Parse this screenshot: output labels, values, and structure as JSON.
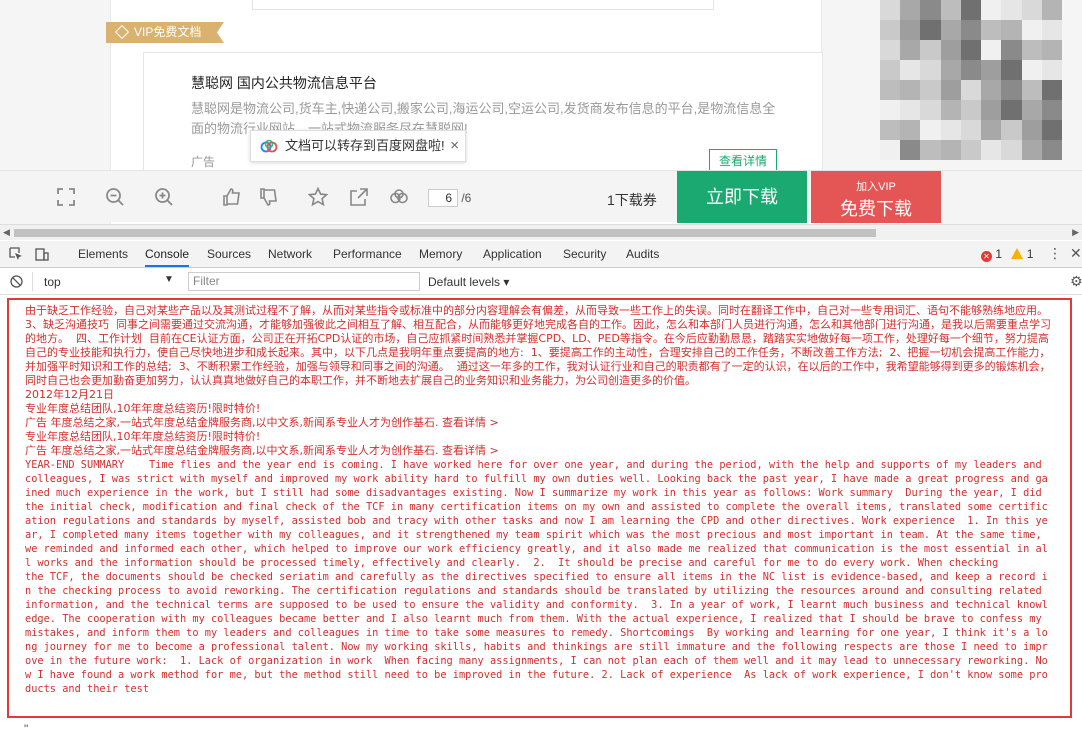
{
  "vip_tag": "VIP免费文档",
  "ad": {
    "title": "慧聪网 国内公共物流信息平台",
    "desc": "慧聪网是物流公司,货车主,快递公司,搬家公司,海运公司,空运公司,发货商发布信息的平台,是物流信息全面的物流行业网站，一站式物流服务尽在慧聪网!",
    "label": "广告",
    "button": "查看详情"
  },
  "tip": {
    "text": "文档可以转存到百度网盘啦!",
    "close": "×"
  },
  "toolbar": {
    "page_current": "6",
    "page_total": "/6",
    "coupon": "1下载券",
    "download": "立即下载",
    "vip_line1": "加入VIP",
    "vip_line2": "免费下载"
  },
  "devtools": {
    "tabs": [
      "Elements",
      "Console",
      "Sources",
      "Network",
      "Performance",
      "Memory",
      "Application",
      "Security",
      "Audits"
    ],
    "active_tab": "Console",
    "error_count": "1",
    "warning_count": "1",
    "context": "top",
    "filter_placeholder": "Filter",
    "levels": "Default levels"
  },
  "console_lines": {
    "l1": "由于缺乏工作经验，自己对某些产品以及其测试过程不了解，从而对某些指令或标准中的部分内容理解会有偏差，从而导致一些工作上的失误。同时在翻译工作中，自己对一些专用词汇、语句不能够熟练地应用。  3、缺乏沟通技巧  同事之间需要通过交流沟通，才能够加强彼此之间相互了解、相互配合，从而能够更好地完成各自的工作。因此，怎么和本部门人员进行沟通，怎么和其他部门进行沟通，是我以后需要重点学习的地方。  四、工作计划  目前在CE认证方面，公司正在开拓CPD认证的市场，自己应抓紧时间熟悉并掌握CPD、LD、PED等指令。在今后应勤勤恳恳，踏踏实实地做好每一项工作，处理好每一个细节，努力提高自己的专业技能和执行力，使自己尽快地进步和成长起来。其中，以下几点是我明年重点要提高的地方:  1、要提高工作的主动性，合理安排自己的工作任务，不断改善工作方法;  2、把握一切机会提高工作能力，并加强平时知识和工作的总结;  3、不断积累工作经验，加强与领导和同事之间的沟通。  通过这一年多的工作，我对认证行业和自己的职责都有了一定的认识，在以后的工作中，我希望能够得到更多的锻炼机会，同时自己也会更加勤奋更加努力，认认真真地做好自己的本职工作，并不断地去扩展自己的业务知识和业务能力，为公司创造更多的价值。                                                                                                              2012年12月21日",
    "l2": "专业年度总结团队,10年年度总结资历!限时特价!",
    "l3": "广告 年度总结之家,一站式年度总结金牌服务商,以中文系,新闻系专业人才为创作基石. 查看详情 >",
    "l4": "专业年度总结团队,10年年度总结资历!限时特价!",
    "l5": "广告 年度总结之家,一站式年度总结金牌服务商,以中文系,新闻系专业人才为创作基石. 查看详情 >",
    "l6": "YEAR-END SUMMARY    Time flies and the year end is coming. I have worked here for over one year, and during the period, with the help and supports of my leaders and colleagues, I was strict with myself and improved my work ability hard to fulfill my own duties well. Looking back the past year, I have made a great progress and gained much experience in the work, but I still had some disadvantages existing. Now I summarize my work in this year as follows: Work summary  During the year, I did the initial check, modification and final check of the TCF in many certification items on my own and assisted to complete the overall items, translated some certification regulations and standards by myself, assisted bob and tracy with other tasks and now I am learning the CPD and other directives. Work experience  1. In this year, I completed many items together with my colleagues, and it strengthened my team spirit which was the most precious and most important in team. At the same time, we reminded and informed each other, which helped to improve our work efficiency greatly, and it also made me realized that communication is the most essential in all works and the information should be processed timely, effectively and clearly.  2.  It should be precise and careful for me to do every work. When checking\nthe TCF, the documents should be checked seriatim and carefully as the directives specified to ensure all items in the NC list is evidence-based, and keep a record in the checking process to avoid reworking. The certification regulations and standards should be translated by utilizing the resources around and consulting related information, and the technical terms are supposed to be used to ensure the validity and conformity.  3. In a year of work, I learnt much business and technical knowledge. The cooperation with my colleagues became better and I also learnt much from them. With the actual experience, I realized that I should be brave to confess my mistakes, and inform them to my leaders and colleagues in time to take some measures to remedy. Shortcomings  By working and learning for one year, I think it's a long journey for me to become a professional talent. Now my working skills, habits and thinkings are still immature and the following respects are those I need to improve in the future work:  1. Lack of organization in work  When facing many assignments, I can not plan each of them well and it may lead to unnecessary reworking. Now I have found a work method for me, but the method still need to be improved in the future. 2. Lack of experience  As lack of work experience, I don't know some products and their test"
  },
  "tail": "\""
}
